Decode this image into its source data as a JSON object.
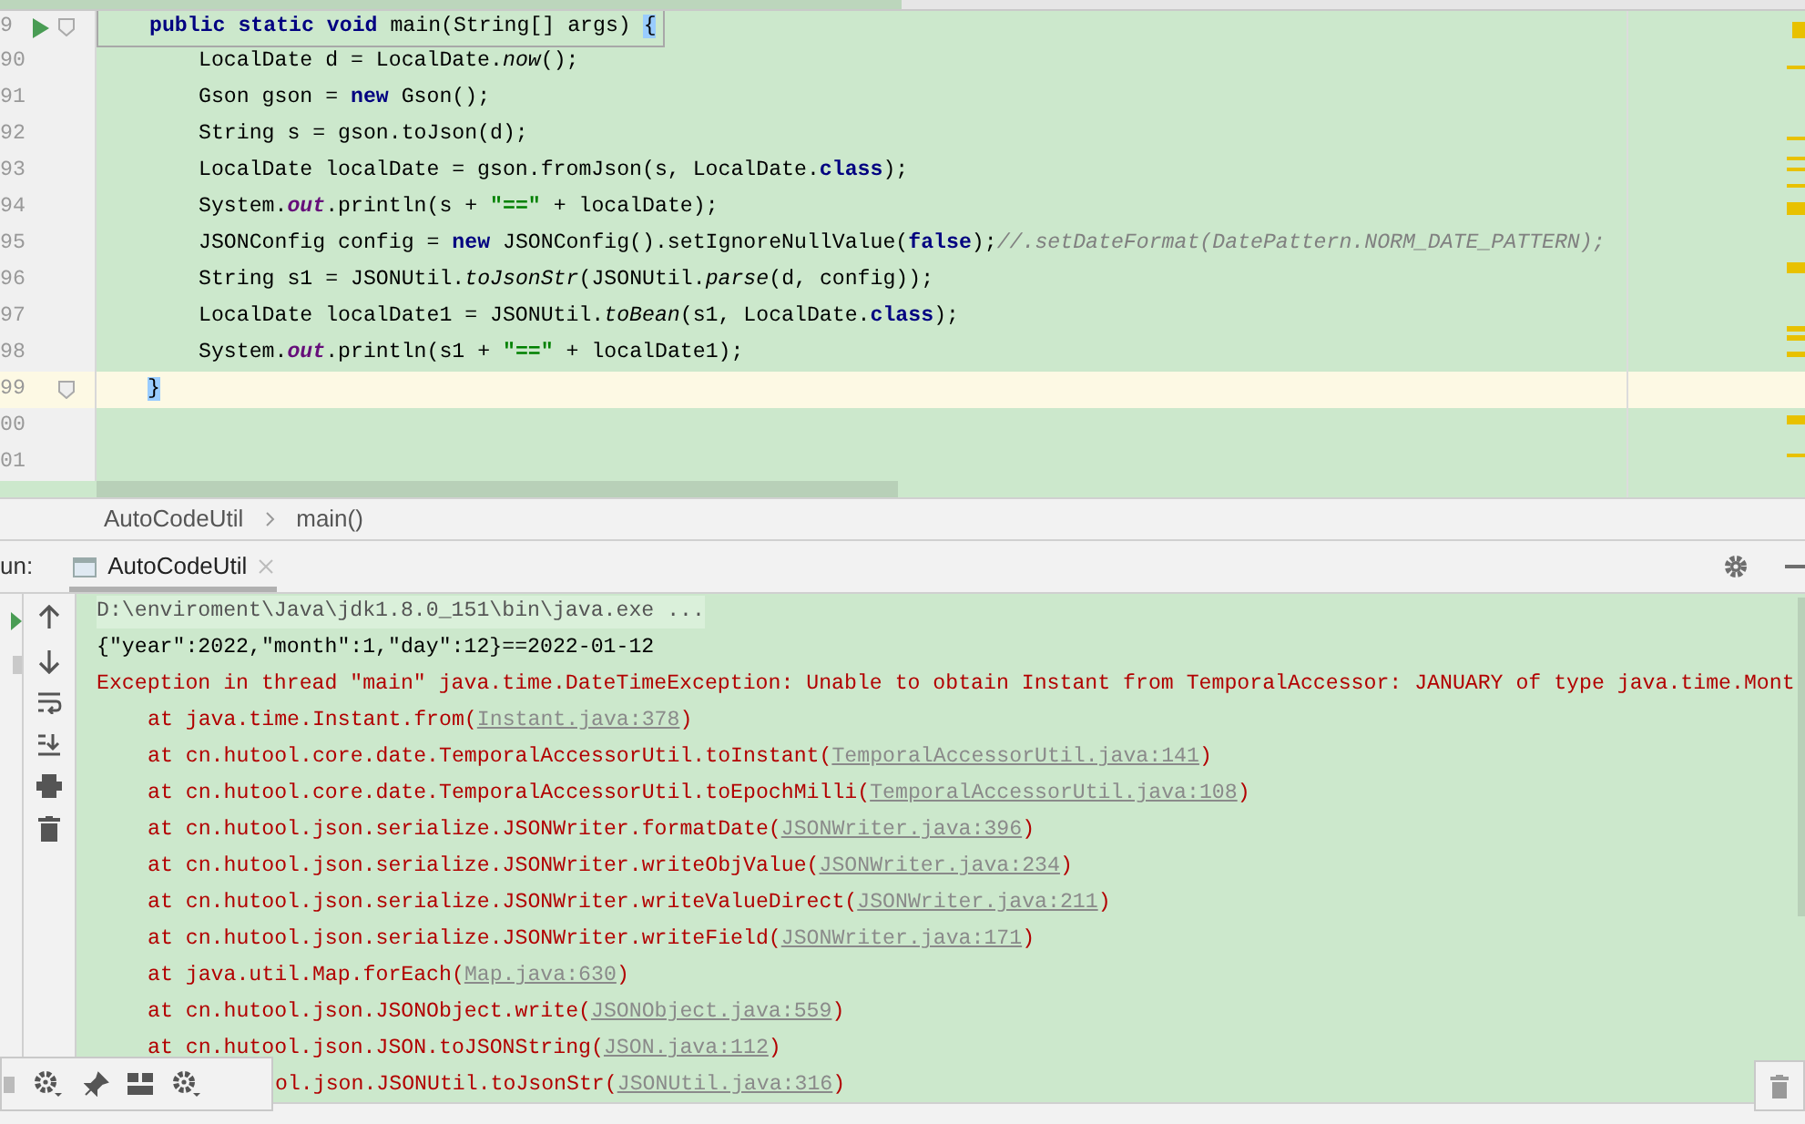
{
  "editor": {
    "lines": [
      {
        "number": "9",
        "kind": "header",
        "run": true,
        "fold": true,
        "current": false,
        "tokens": [
          {
            "kind": "keyword",
            "text": "public static void"
          },
          {
            "kind": "plain",
            "text": " main(String[] args) "
          },
          {
            "kind": "brace",
            "text": "{"
          }
        ]
      },
      {
        "number": "90",
        "kind": "statement",
        "run": false,
        "fold": false,
        "current": false,
        "tokens": [
          {
            "kind": "plain",
            "text": "LocalDate d = LocalDate."
          },
          {
            "kind": "static_method",
            "text": "now"
          },
          {
            "kind": "plain",
            "text": "();"
          }
        ]
      },
      {
        "number": "91",
        "kind": "statement",
        "run": false,
        "fold": false,
        "current": false,
        "tokens": [
          {
            "kind": "plain",
            "text": "Gson gson = "
          },
          {
            "kind": "keyword",
            "text": "new"
          },
          {
            "kind": "plain",
            "text": " Gson();"
          }
        ]
      },
      {
        "number": "92",
        "kind": "statement",
        "run": false,
        "fold": false,
        "current": false,
        "tokens": [
          {
            "kind": "plain",
            "text": "String s = gson.toJson(d);"
          }
        ]
      },
      {
        "number": "93",
        "kind": "statement",
        "run": false,
        "fold": false,
        "current": false,
        "tokens": [
          {
            "kind": "plain",
            "text": "LocalDate localDate = gson.fromJson(s, LocalDate."
          },
          {
            "kind": "keyword",
            "text": "class"
          },
          {
            "kind": "plain",
            "text": ");"
          }
        ]
      },
      {
        "number": "94",
        "kind": "statement",
        "run": false,
        "fold": false,
        "current": false,
        "tokens": [
          {
            "kind": "plain",
            "text": "System."
          },
          {
            "kind": "static_field",
            "text": "out"
          },
          {
            "kind": "plain",
            "text": ".println(s + "
          },
          {
            "kind": "string",
            "text": "\"==\""
          },
          {
            "kind": "plain",
            "text": " + localDate);"
          }
        ]
      },
      {
        "number": "95",
        "kind": "statement",
        "run": false,
        "fold": false,
        "current": false,
        "tokens": [
          {
            "kind": "plain",
            "text": "JSONConfig config = "
          },
          {
            "kind": "keyword",
            "text": "new"
          },
          {
            "kind": "plain",
            "text": " JSONConfig().setIgnoreNullValue("
          },
          {
            "kind": "keyword",
            "text": "false"
          },
          {
            "kind": "plain",
            "text": ");"
          },
          {
            "kind": "comment",
            "text": "//.setDateFormat(DatePattern.NORM_DATE_PATTERN);"
          }
        ]
      },
      {
        "number": "96",
        "kind": "statement",
        "run": false,
        "fold": false,
        "current": false,
        "tokens": [
          {
            "kind": "plain",
            "text": "String s1 = JSONUtil."
          },
          {
            "kind": "static_method",
            "text": "toJsonStr"
          },
          {
            "kind": "plain",
            "text": "(JSONUtil."
          },
          {
            "kind": "static_method",
            "text": "parse"
          },
          {
            "kind": "plain",
            "text": "(d, config));"
          }
        ]
      },
      {
        "number": "97",
        "kind": "statement",
        "run": false,
        "fold": false,
        "current": false,
        "tokens": [
          {
            "kind": "plain",
            "text": "LocalDate localDate1 = JSONUtil."
          },
          {
            "kind": "static_method",
            "text": "toBean"
          },
          {
            "kind": "plain",
            "text": "(s1, LocalDate."
          },
          {
            "kind": "keyword",
            "text": "class"
          },
          {
            "kind": "plain",
            "text": ");"
          }
        ]
      },
      {
        "number": "98",
        "kind": "statement",
        "run": false,
        "fold": false,
        "current": false,
        "tokens": [
          {
            "kind": "plain",
            "text": "System."
          },
          {
            "kind": "static_field",
            "text": "out"
          },
          {
            "kind": "plain",
            "text": ".println(s1 + "
          },
          {
            "kind": "string",
            "text": "\"==\""
          },
          {
            "kind": "plain",
            "text": " + localDate1);"
          }
        ]
      },
      {
        "number": "99",
        "kind": "closing",
        "run": false,
        "fold": true,
        "current": true,
        "tokens": [
          {
            "kind": "brace",
            "text": "}"
          }
        ]
      },
      {
        "number": "00",
        "kind": "blank",
        "run": false,
        "fold": false,
        "current": false
      },
      {
        "number": "01",
        "kind": "blank",
        "run": false,
        "fold": false,
        "current": false
      }
    ]
  },
  "breadcrumbs": [
    "AutoCodeUtil",
    "main()"
  ],
  "run_panel": {
    "label": "un:",
    "tabs": [
      {
        "label": "AutoCodeUtil",
        "selected": true
      }
    ],
    "console": [
      {
        "kind": "command",
        "text": "D:\\enviroment\\Java\\jdk1.8.0_151\\bin\\java.exe ..."
      },
      {
        "kind": "output",
        "text": "{\"year\":2022,\"month\":1,\"day\":12}==2022-01-12"
      },
      {
        "kind": "error",
        "text": "Exception in thread \"main\" java.time.DateTimeException: Unable to obtain Instant from TemporalAccessor: JANUARY of type java.time.Mont"
      },
      {
        "kind": "stack",
        "text": "at java.time.Instant.from(",
        "link": "Instant.java:378",
        "suffix": ")"
      },
      {
        "kind": "stack",
        "text": "at cn.hutool.core.date.TemporalAccessorUtil.toInstant(",
        "link": "TemporalAccessorUtil.java:141",
        "suffix": ")"
      },
      {
        "kind": "stack",
        "text": "at cn.hutool.core.date.TemporalAccessorUtil.toEpochMilli(",
        "link": "TemporalAccessorUtil.java:108",
        "suffix": ")"
      },
      {
        "kind": "stack",
        "text": "at cn.hutool.json.serialize.JSONWriter.formatDate(",
        "link": "JSONWriter.java:396",
        "suffix": ")"
      },
      {
        "kind": "stack",
        "text": "at cn.hutool.json.serialize.JSONWriter.writeObjValue(",
        "link": "JSONWriter.java:234",
        "suffix": ")"
      },
      {
        "kind": "stack",
        "text": "at cn.hutool.json.serialize.JSONWriter.writeValueDirect(",
        "link": "JSONWriter.java:211",
        "suffix": ")"
      },
      {
        "kind": "stack",
        "text": "at cn.hutool.json.serialize.JSONWriter.writeField(",
        "link": "JSONWriter.java:171",
        "suffix": ")"
      },
      {
        "kind": "stack",
        "text": "at java.util.Map.forEach(",
        "link": "Map.java:630",
        "suffix": ")"
      },
      {
        "kind": "stack",
        "text": "at cn.hutool.json.JSONObject.write(",
        "link": "JSONObject.java:559",
        "suffix": ")"
      },
      {
        "kind": "stack",
        "text": "at cn.hutool.json.JSON.toJSONString(",
        "link": "JSON.java:112",
        "suffix": ")"
      },
      {
        "kind": "covered",
        "text": "ol.json.JSONUtil.toJsonStr(",
        "link": "JSONUtil.java:316",
        "suffix": ")"
      }
    ]
  }
}
